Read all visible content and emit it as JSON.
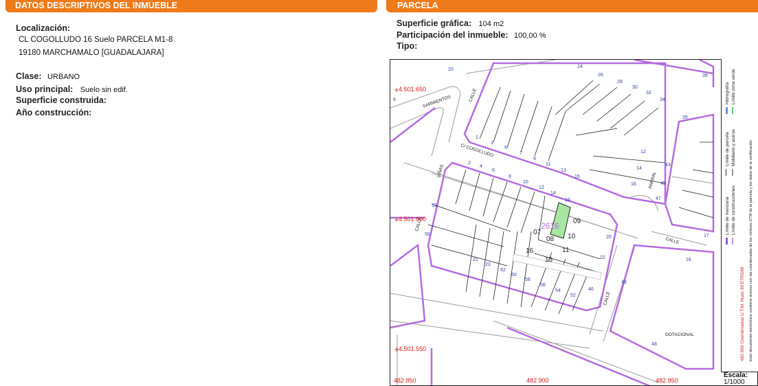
{
  "left": {
    "title": "DATOS DESCRIPTIVOS DEL INMUEBLE",
    "localizacion_label": "Localización:",
    "address_line1": "CL COGOLLUDO 16 Suelo PARCELA M1-8",
    "address_line2": "19180 MARCHAMALO [GUADALAJARA]",
    "clase_label": "Clase:",
    "clase_value": "URBANO",
    "uso_label": "Uso principal:",
    "uso_value": "Suelo sin edif.",
    "superficie_label": "Superficie construida:",
    "anio_label": "Año construcción:"
  },
  "right": {
    "title": "PARCELA",
    "superficie_label": "Superficie gráfica:",
    "superficie_value": "104 m2",
    "participacion_label": "Participación del inmueble:",
    "participacion_value": "100,00 %",
    "tipo_label": "Tipo:"
  },
  "map": {
    "coords": {
      "y_top": "4.501.650",
      "y_mid": "4.501.600",
      "y_bot": "4.501.550",
      "x_left": "482.850",
      "x_mid": "482.900",
      "x_right": "482.950"
    },
    "streets": {
      "sarmientos": "SARMIENTOS",
      "calle_top": "CALLE",
      "cogolludo": "C/ COGOLLUDO",
      "vinas": "VIÑAS",
      "calle_left": "CALLE",
      "parral": "PARRAL",
      "calle_right": "CALLE",
      "calle_bottom": "CALLE",
      "dotacional": "DOTACIONAL"
    },
    "parcel_ref": "2616",
    "parcel_labels": {
      "p07": "07",
      "p08": "08",
      "p09": "09",
      "p10": "10",
      "p11": "11",
      "p15": "15",
      "p16": "16"
    },
    "house_numbers_south": [
      "2",
      "4",
      "6",
      "8",
      "10",
      "12",
      "14",
      "16",
      "18",
      "20",
      "22",
      "46",
      "50",
      "52",
      "54",
      "56",
      "58",
      "60",
      "62",
      "23",
      "21",
      "19"
    ],
    "house_numbers_north": [
      "1",
      "3",
      "5",
      "7",
      "9",
      "11",
      "13",
      "15",
      "16",
      "14",
      "12",
      "20",
      "24",
      "26",
      "28",
      "30",
      "32",
      "34"
    ],
    "house_numbers_misc": [
      "39",
      "35",
      "43",
      "45",
      "47",
      "17",
      "16",
      "49",
      "48",
      "6",
      "26"
    ],
    "colors": {
      "block_limit": "#b36be0",
      "parcel_highlight": "#a8e6a1",
      "coord_text": "#d11c1c",
      "header": "#ee7a1a"
    }
  },
  "legend": {
    "item1": "Límite de manzana",
    "item2": "Límite de parcela",
    "item3": "Hidrografía",
    "item4": "Límite de construcciones",
    "item5": "Mobiliario y aceras",
    "item6": "Límite zona verde",
    "coord_note": "482.950 Coordenadas U.T.M. Huso 30 ETRS89",
    "note": "Este documento electrónico contiene anexos con las coordenadas de los vértices UTM de la parcela y los datos de la certificación",
    "scale_label": "Escala:",
    "scale_value": "1/1000"
  }
}
